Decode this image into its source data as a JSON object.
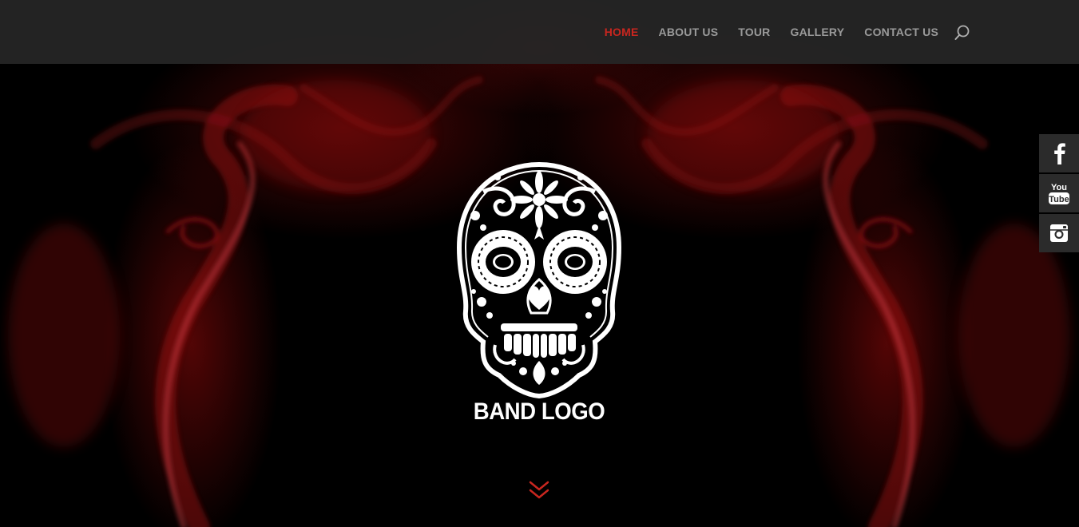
{
  "header": {
    "nav": [
      {
        "label": "HOME",
        "active": true
      },
      {
        "label": "ABOUT US",
        "active": false
      },
      {
        "label": "TOUR",
        "active": false
      },
      {
        "label": "GALLERY",
        "active": false
      },
      {
        "label": "CONTACT US",
        "active": false
      }
    ],
    "search_icon": "search-icon"
  },
  "social": [
    {
      "icon": "facebook-icon",
      "glyph": "f"
    },
    {
      "icon": "youtube-icon",
      "glyph_top": "You",
      "glyph_bottom": "Tube"
    },
    {
      "icon": "instagram-icon"
    }
  ],
  "hero": {
    "logo_icon": "sugar-skull-icon",
    "title": "BAND LOGO",
    "scroll_icon": "double-chevron-down-icon"
  },
  "colors": {
    "accent": "#c8261f",
    "nav_text": "#9a9a9a",
    "header_bg": "#262626",
    "social_bg": "#2b2b2b",
    "logo": "#ffffff"
  }
}
